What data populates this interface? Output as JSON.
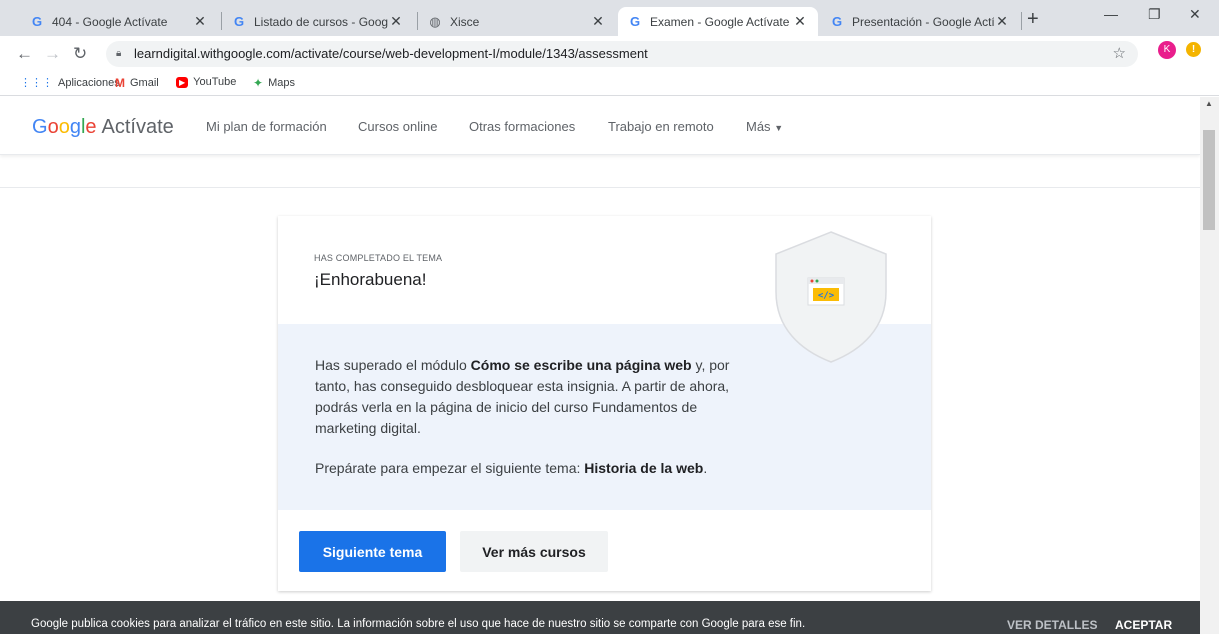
{
  "browser": {
    "tabs": [
      {
        "title": "404 - Google Actívate",
        "icon": "google-icon"
      },
      {
        "title": "Listado de cursos - Google Acti",
        "icon": "google-icon"
      },
      {
        "title": "Xisce",
        "icon": "globe-icon"
      },
      {
        "title": "Examen - Google Actívate",
        "icon": "google-icon",
        "active": true
      },
      {
        "title": "Presentación - Google Actívate",
        "icon": "google-icon"
      }
    ],
    "url": "learndigital.withgoogle.com/activate/course/web-development-I/module/1343/assessment",
    "profile_initial": "K",
    "bookmarks": [
      {
        "label": "Aplicaciones",
        "icon": "apps-grid-icon"
      },
      {
        "label": "Gmail",
        "icon": "gmail-icon"
      },
      {
        "label": "YouTube",
        "icon": "youtube-icon"
      },
      {
        "label": "Maps",
        "icon": "maps-icon"
      }
    ]
  },
  "site": {
    "logo_google": "Google",
    "logo_activate": "Actívate",
    "nav": [
      "Mi plan de formación",
      "Cursos online",
      "Otras formaciones",
      "Trabajo en remoto",
      "Más"
    ]
  },
  "card": {
    "eyebrow": "HAS COMPLETADO EL TEMA",
    "headline": "¡Enhorabuena!",
    "para1_pre": "Has superado el módulo ",
    "para1_bold": "Cómo se escribe una página web",
    "para1_post": " y, por tanto, has conseguido desbloquear esta insignia. A partir de ahora, podrás verla en la página de inicio del curso Fundamentos de marketing digital.",
    "para2_pre": "Prepárate para empezar el siguiente tema: ",
    "para2_bold": "Historia de la web",
    "para2_post": ".",
    "primary_button": "Siguiente tema",
    "secondary_button": "Ver más cursos"
  },
  "cookie_bar": {
    "text": "Google publica cookies para analizar el tráfico en este sitio. La información sobre el uso que hace de nuestro sitio se comparte con Google para ese fin.",
    "details": "VER DETALLES",
    "accept": "ACEPTAR"
  },
  "colors": {
    "primary": "#1a73e8",
    "panel_bg": "#eef3fb",
    "cookie_bg": "#3c4043"
  }
}
